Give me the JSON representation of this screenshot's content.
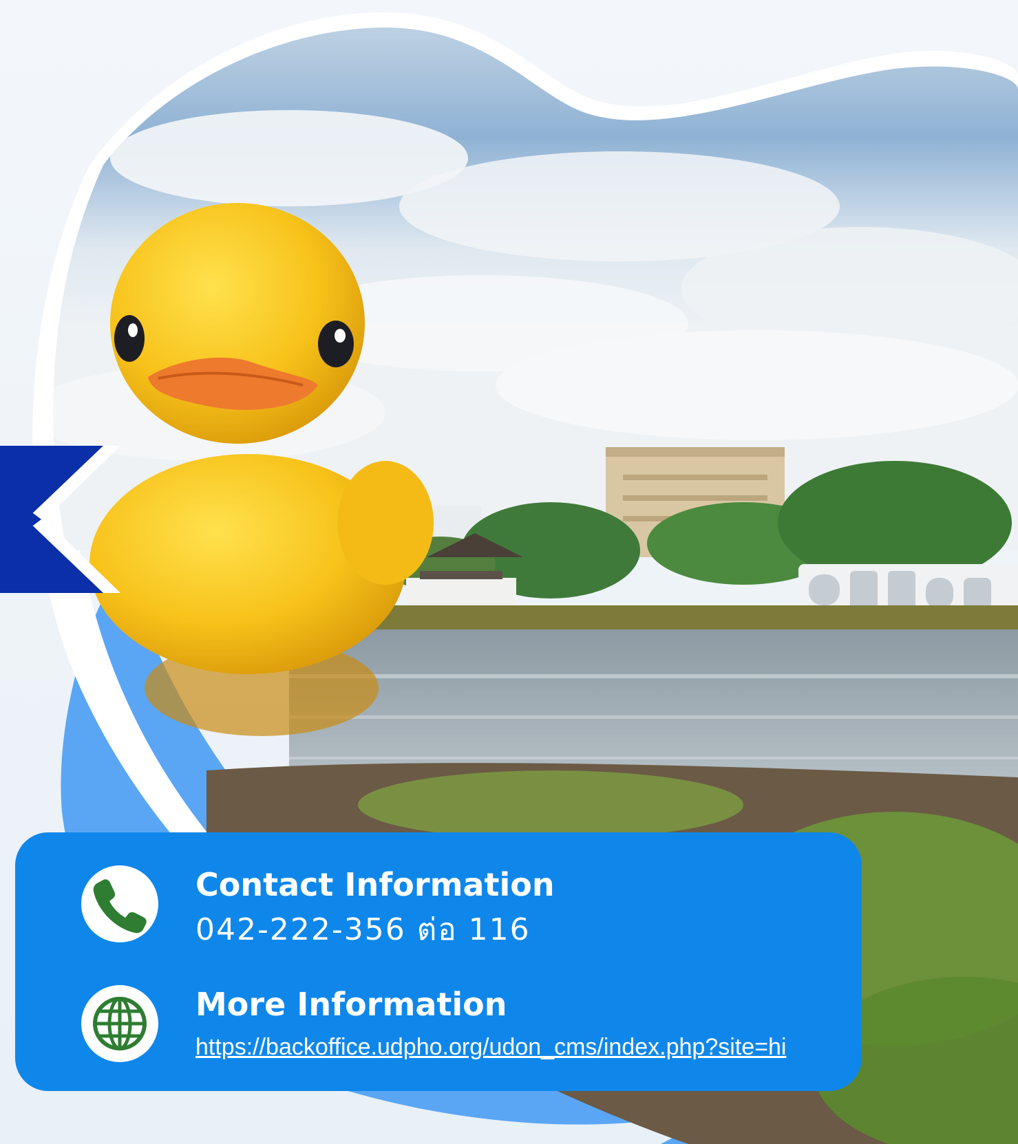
{
  "contact": {
    "heading": "Contact Information",
    "value": "042-222-356 ต่อ 116",
    "icon": "phone-icon"
  },
  "more": {
    "heading": "More Information",
    "link": "https://backoffice.udpho.org/udon_cms/index.php?site=hi",
    "icon": "globe-icon"
  },
  "colors": {
    "panel": "#0f87ea",
    "accent_blue": "#5aa6f5",
    "chevron": "#0a2fa8",
    "icon_green": "#2e7d32"
  }
}
